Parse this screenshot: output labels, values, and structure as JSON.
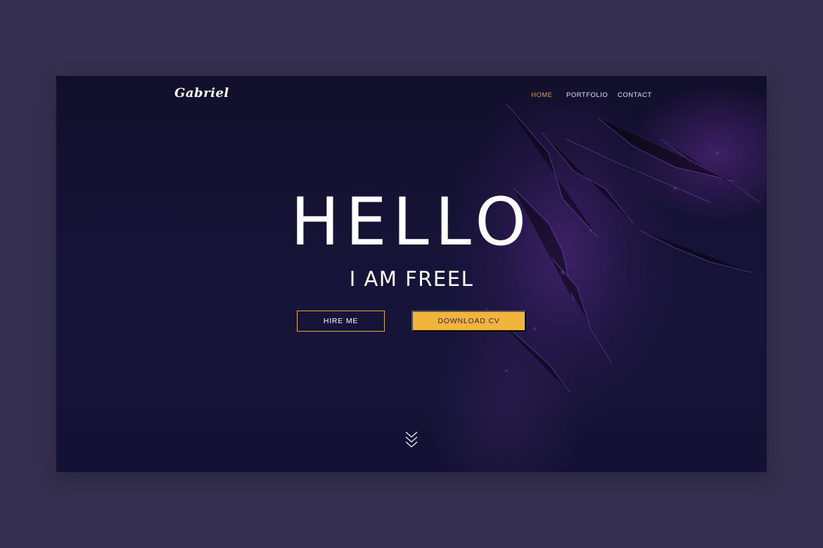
{
  "brand": {
    "logo_text": "Gabriel"
  },
  "nav": {
    "items": [
      {
        "label": "HOME",
        "active": true
      },
      {
        "label": "PORTFOLIO",
        "active": false
      },
      {
        "label": "CONTACT",
        "active": false
      }
    ]
  },
  "hero": {
    "headline": "HELLO",
    "subheadline": "I AM FREEL",
    "primary_button": "HIRE ME",
    "secondary_button": "DOWNLOAD CV",
    "scroll_icon": "chevrons-down-icon"
  },
  "colors": {
    "page_background": "#363050",
    "hero_background": "#17143a",
    "accent": "#f2b43a",
    "active_nav": "#d6a23b",
    "text": "#ffffff"
  }
}
